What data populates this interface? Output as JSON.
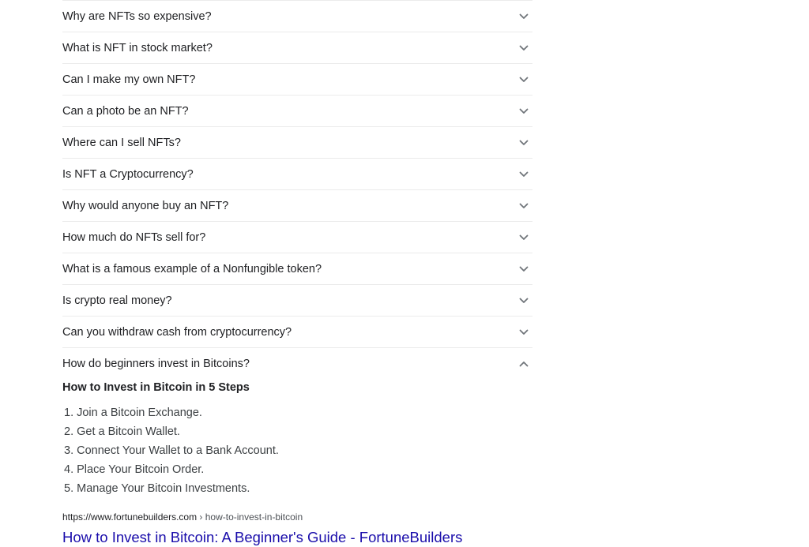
{
  "questions": [
    {
      "text": "Why are NFTs so expensive?",
      "expanded": false
    },
    {
      "text": "What is NFT in stock market?",
      "expanded": false
    },
    {
      "text": "Can I make my own NFT?",
      "expanded": false
    },
    {
      "text": "Can a photo be an NFT?",
      "expanded": false
    },
    {
      "text": "Where can I sell NFTs?",
      "expanded": false
    },
    {
      "text": "Is NFT a Cryptocurrency?",
      "expanded": false
    },
    {
      "text": "Why would anyone buy an NFT?",
      "expanded": false
    },
    {
      "text": "How much do NFTs sell for?",
      "expanded": false
    },
    {
      "text": "What is a famous example of a Nonfungible token?",
      "expanded": false
    },
    {
      "text": "Is crypto real money?",
      "expanded": false
    },
    {
      "text": "Can you withdraw cash from cryptocurrency?",
      "expanded": false
    },
    {
      "text": "How do beginners invest in Bitcoins?",
      "expanded": true
    }
  ],
  "answer": {
    "title": "How to Invest in Bitcoin in 5 Steps",
    "steps": [
      "1. Join a Bitcoin Exchange.",
      "2. Get a Bitcoin Wallet.",
      "3. Connect Your Wallet to a Bank Account.",
      "4. Place Your Bitcoin Order.",
      "5. Manage Your Bitcoin Investments."
    ],
    "source": {
      "domain": "https://www.fortunebuilders.com",
      "path": " › how-to-invest-in-bitcoin",
      "title": "How to Invest in Bitcoin: A Beginner's Guide - FortuneBuilders"
    }
  },
  "icons": {
    "collapsed": "chevron-down-icon",
    "expanded": "chevron-up-icon"
  },
  "colors": {
    "link": "#1a0dab",
    "text": "#202124",
    "divider": "#ebebeb",
    "icon": "#70757a"
  }
}
